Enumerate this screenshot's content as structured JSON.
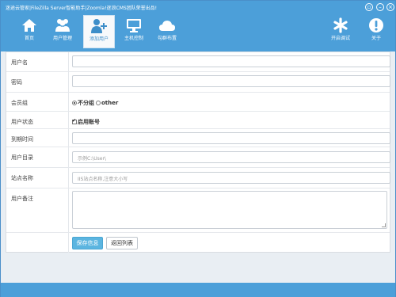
{
  "window": {
    "title": "迷途云管家|FileZilla Server智能助手|Zoomla!逐浪CMS团队荣誉出品!"
  },
  "toolbar": {
    "items": [
      {
        "label": "首页",
        "icon": "home-icon"
      },
      {
        "label": "用户管理",
        "icon": "users-icon"
      },
      {
        "label": "添加用户",
        "icon": "add-user-icon"
      },
      {
        "label": "主机控制",
        "icon": "monitor-icon"
      },
      {
        "label": "勾群布置",
        "icon": "cloud-icon"
      }
    ],
    "right_items": [
      {
        "label": "开启调试",
        "icon": "asterisk-icon"
      },
      {
        "label": "关于",
        "icon": "info-icon"
      }
    ],
    "active": "添加用户"
  },
  "form": {
    "username": {
      "label": "用户名",
      "value": ""
    },
    "password": {
      "label": "密码",
      "value": ""
    },
    "group": {
      "label": "会员组",
      "options": [
        "不分组",
        "other"
      ],
      "selected": "不分组"
    },
    "status": {
      "label": "用户状态",
      "checkbox_label": "启用账号",
      "checked": true
    },
    "expire": {
      "label": "到期时间",
      "value": ""
    },
    "directory": {
      "label": "用户目录",
      "placeholder": "示例C:\\User\\"
    },
    "site": {
      "label": "站点名称",
      "placeholder": "IIS站点名称,注意大小写"
    },
    "note": {
      "label": "用户备注",
      "value": ""
    },
    "buttons": {
      "save": "保存信息",
      "back": "返回列表"
    }
  },
  "colors": {
    "accent": "#4c9fd9",
    "primary_button": "#5bb5e0"
  }
}
